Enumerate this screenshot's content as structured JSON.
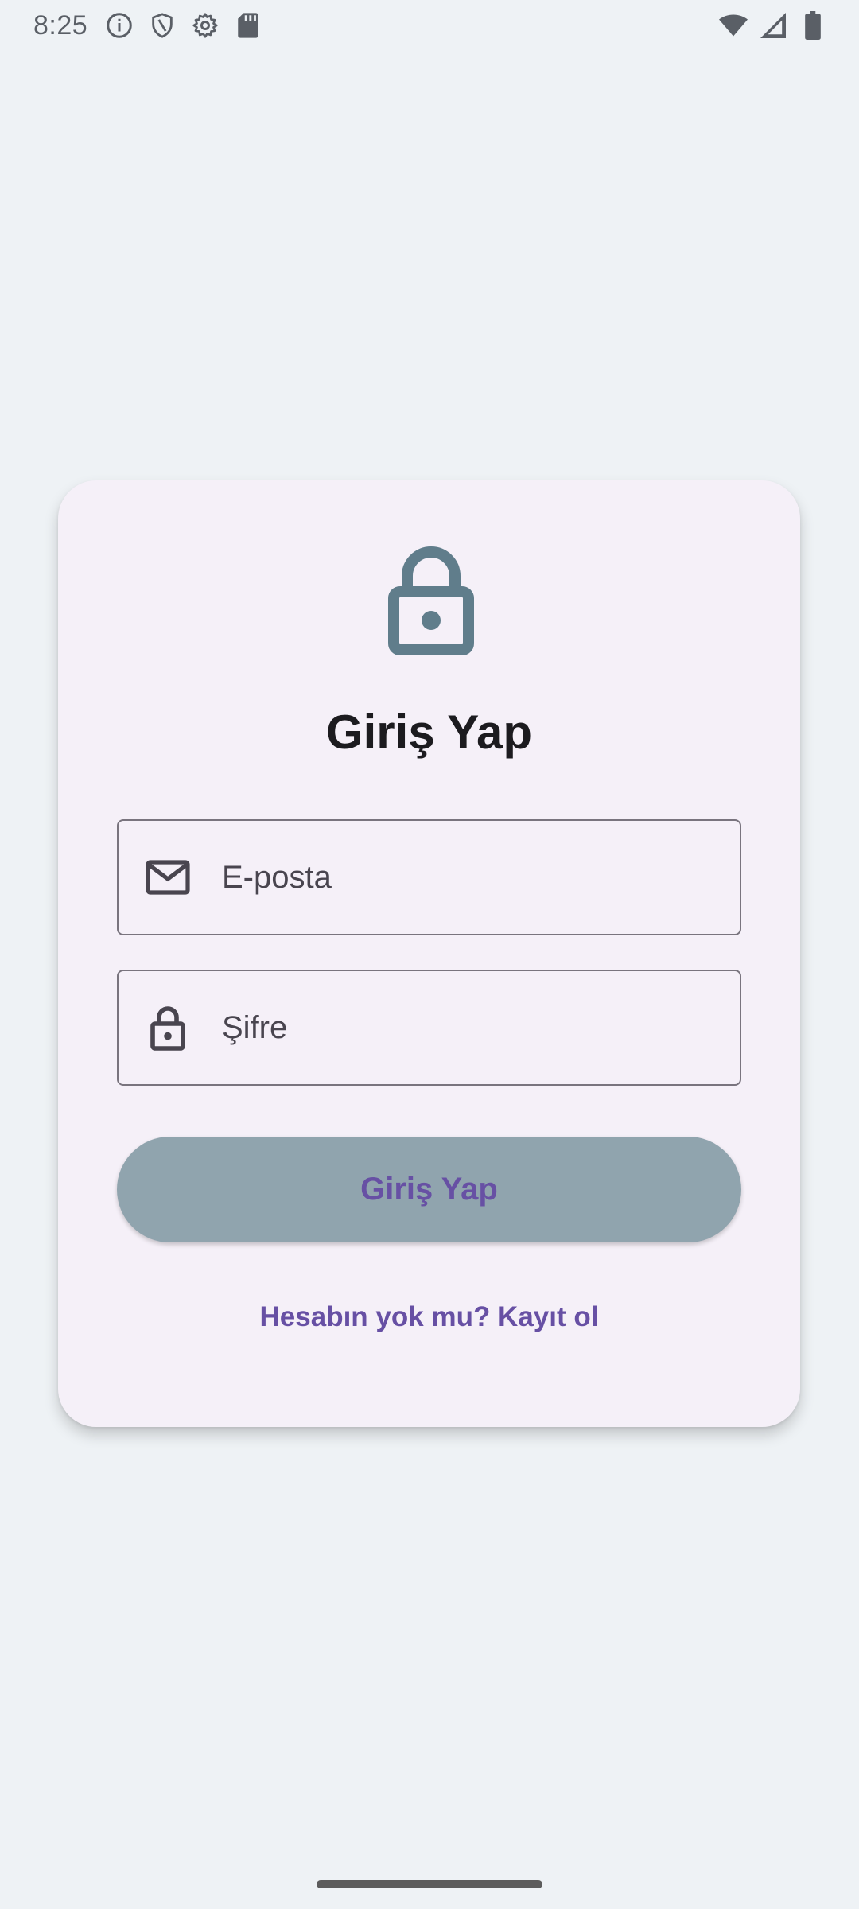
{
  "status_bar": {
    "time": "8:25",
    "icons": [
      "info-icon",
      "shield-icon",
      "gear-icon",
      "sd-card-icon",
      "wifi-icon",
      "signal-icon",
      "battery-icon"
    ]
  },
  "login": {
    "title": "Giriş Yap",
    "email_placeholder": "E-posta",
    "password_placeholder": "Şifre",
    "submit_label": "Giriş Yap",
    "register_link": "Hesabın yok mu? Kayıt ol"
  },
  "colors": {
    "background": "#eef2f5",
    "card": "#f5f0f8",
    "accent": "#6750a4",
    "button": "#90a4ae",
    "lock_icon": "#607d8b"
  }
}
